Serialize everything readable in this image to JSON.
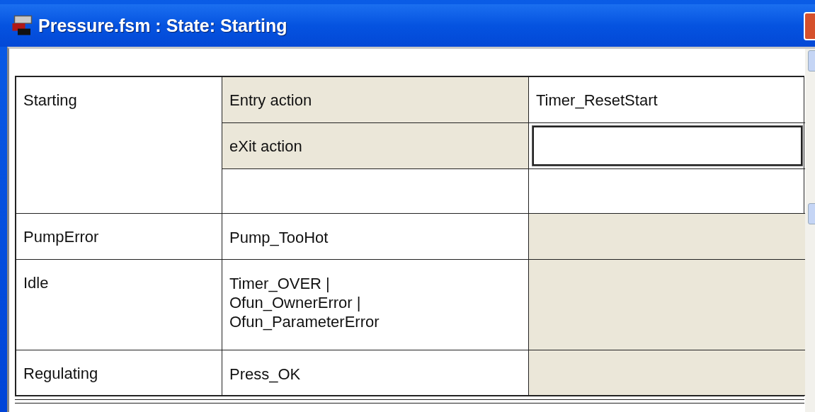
{
  "window": {
    "title": "Pressure.fsm : State: Starting"
  },
  "state": {
    "name": "Starting",
    "actions": [
      {
        "label": "Entry action",
        "value": "Timer_ResetStart",
        "kind": "text"
      },
      {
        "label": "eXit action",
        "kind": "field"
      }
    ]
  },
  "transitions": [
    {
      "target": "PumpError",
      "event": "Pump_TooHot"
    },
    {
      "target": "Idle",
      "event": "Timer_OVER |\nOfun_OwnerError |\nOfun_ParameterError"
    },
    {
      "target": "Regulating",
      "event": "Press_OK"
    }
  ]
}
